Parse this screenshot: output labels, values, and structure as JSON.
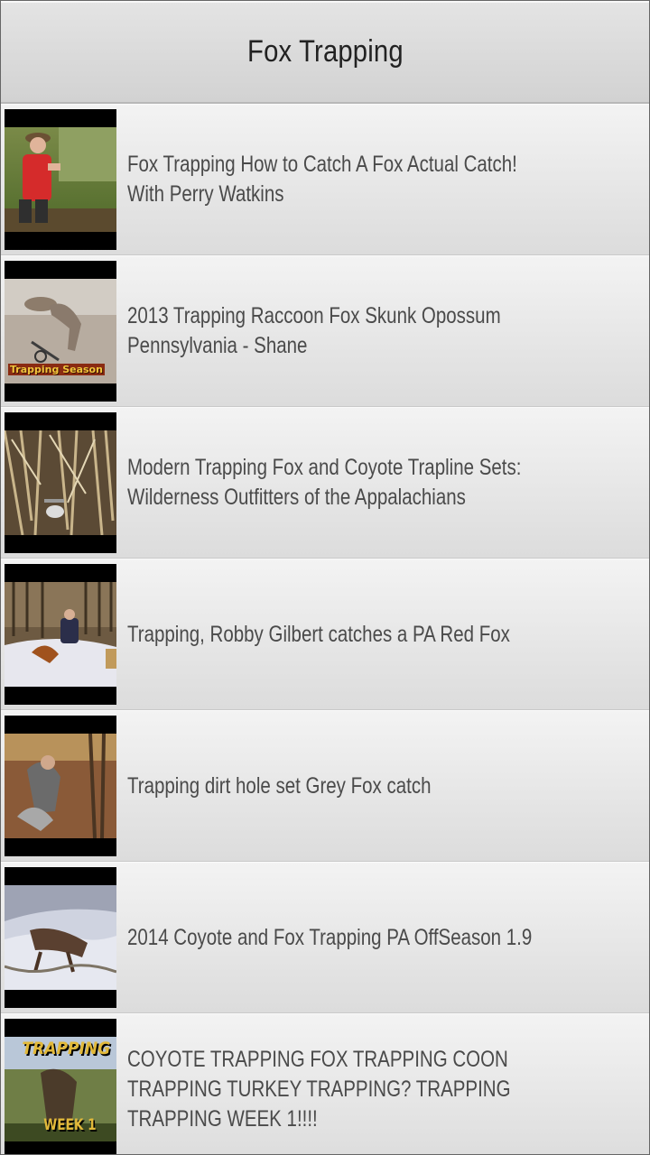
{
  "header": {
    "title": "Fox Trapping"
  },
  "videos": [
    {
      "title": "Fox Trapping How to Catch A Fox Actual Catch! With Perry Watkins",
      "thumb_icon": "man-in-red-shirt-thumbnail"
    },
    {
      "title": "2013 Trapping Raccoon Fox Skunk Opossum Pennsylvania - Shane",
      "thumb_icon": "fox-in-trap-thumbnail",
      "thumb_caption": "Trapping Season"
    },
    {
      "title": "Modern Trapping Fox and Coyote Trapline Sets: Wilderness Outfitters of the Appalachians",
      "thumb_icon": "trap-in-brush-thumbnail"
    },
    {
      "title": "Trapping, Robby Gilbert catches a PA Red Fox",
      "thumb_icon": "trapper-in-snow-thumbnail"
    },
    {
      "title": "Trapping dirt hole set Grey Fox catch",
      "thumb_icon": "grey-fox-catch-thumbnail"
    },
    {
      "title": "2014 Coyote and Fox Trapping PA OffSeason 1.9",
      "thumb_icon": "coyote-in-snow-thumbnail"
    },
    {
      "title": "COYOTE TRAPPING FOX TRAPPING COON TRAPPING TURKEY TRAPPING? TRAPPING TRAPPING WEEK 1!!!!",
      "thumb_icon": "trapping-week-1-thumbnail",
      "thumb_caption": "TRAPPING",
      "thumb_caption2": "WEEK 1"
    }
  ]
}
